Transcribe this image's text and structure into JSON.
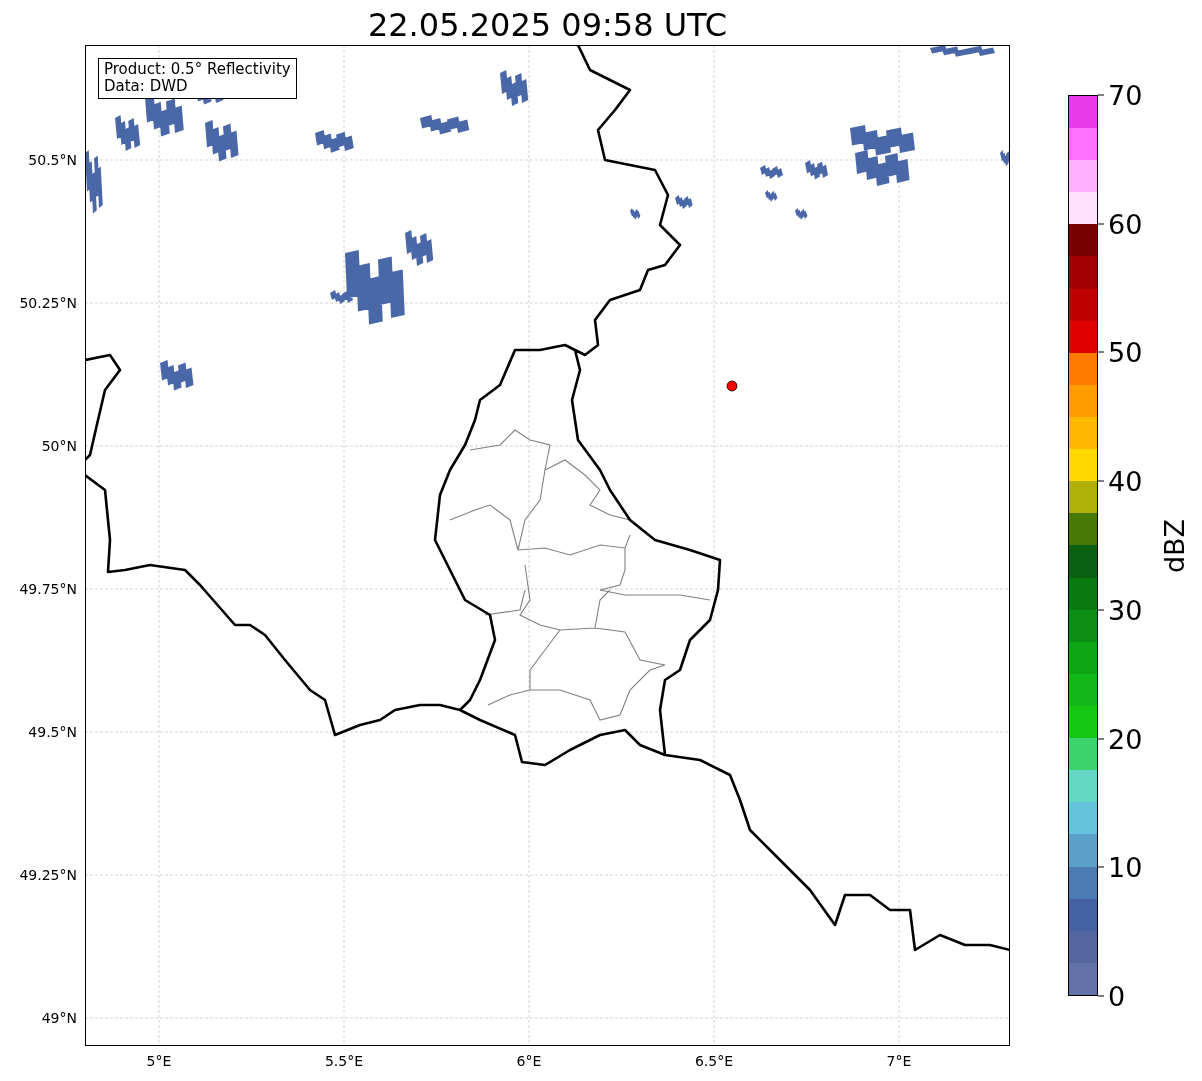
{
  "title": "22.05.2025 09:58 UTC",
  "info_box": {
    "product": "Product: 0.5° Reflectivity",
    "data": "Data: DWD"
  },
  "lat_labels": [
    "50.5°N",
    "50.25°N",
    "50°N",
    "49.75°N",
    "49.5°N",
    "49.25°N",
    "49°N"
  ],
  "lon_labels": [
    "5°E",
    "5.5°E",
    "6°E",
    "6.5°E",
    "7°E"
  ],
  "colorbar": {
    "label": "dBZ",
    "ticks": [
      "70",
      "60",
      "50",
      "40",
      "30",
      "20",
      "10",
      "0"
    ],
    "bins": [
      {
        "color": "#6272a8"
      },
      {
        "color": "#5466a0"
      },
      {
        "color": "#4461a3"
      },
      {
        "color": "#4b7bb3"
      },
      {
        "color": "#5ba0c8"
      },
      {
        "color": "#66c3de"
      },
      {
        "color": "#64d8c4"
      },
      {
        "color": "#3cd46c"
      },
      {
        "color": "#14c814"
      },
      {
        "color": "#12b81a"
      },
      {
        "color": "#0ea616"
      },
      {
        "color": "#0c8e14"
      },
      {
        "color": "#0a7a10"
      },
      {
        "color": "#086010"
      },
      {
        "color": "#487808"
      },
      {
        "color": "#b0b008"
      },
      {
        "color": "#ffd800"
      },
      {
        "color": "#ffb800"
      },
      {
        "color": "#ff9c00"
      },
      {
        "color": "#ff7c00"
      },
      {
        "color": "#e00000"
      },
      {
        "color": "#c00000"
      },
      {
        "color": "#a00000"
      },
      {
        "color": "#780000"
      },
      {
        "color": "#ffe0ff"
      },
      {
        "color": "#ffb0ff"
      },
      {
        "color": "#ff70ff"
      },
      {
        "color": "#e83ae8"
      }
    ]
  }
}
